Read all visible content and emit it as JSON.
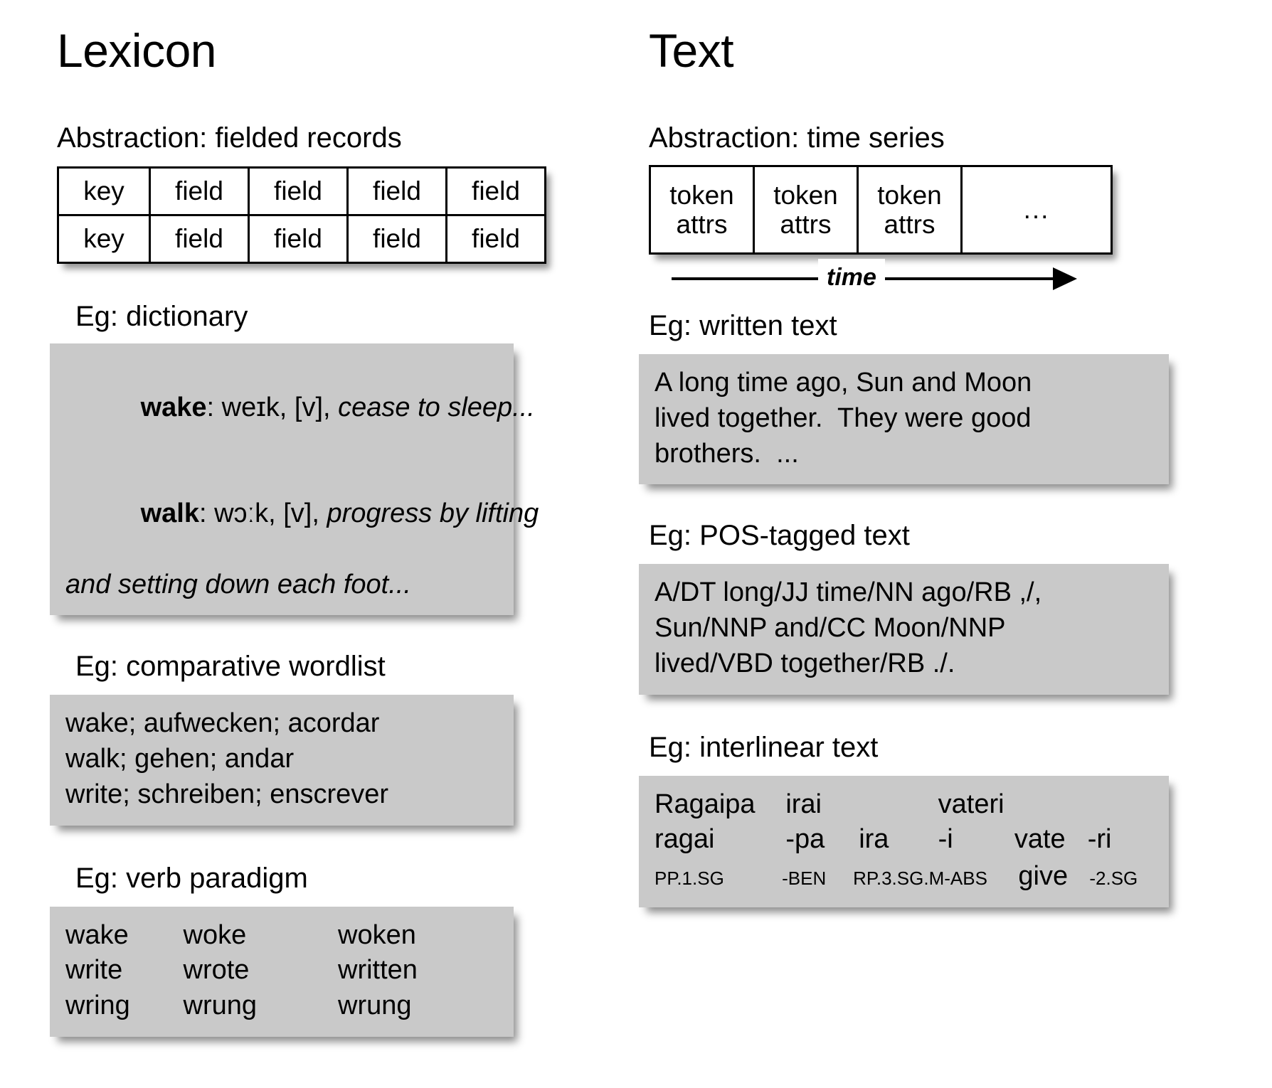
{
  "columns": {
    "lexicon": {
      "title": "Lexicon",
      "abstraction_heading": "Abstraction: fielded records",
      "table": {
        "rows": [
          [
            "key",
            "field",
            "field",
            "field",
            "field"
          ],
          [
            "key",
            "field",
            "field",
            "field",
            "field"
          ]
        ]
      },
      "examples": [
        {
          "heading": "Eg: dictionary",
          "entries": [
            {
              "headword": "wake",
              "separator": ": ",
              "pronunciation": "weɪk, ",
              "pos": "[v], ",
              "definition": "cease to sleep..."
            },
            {
              "headword": "walk",
              "separator": ": ",
              "pronunciation": "wɔːk, ",
              "pos": "[v], ",
              "definition": "progress by lifting",
              "definition_cont": "and setting down each foot..."
            }
          ]
        },
        {
          "heading": "Eg: comparative wordlist",
          "lines": [
            "wake; aufwecken; acordar",
            "walk; gehen; andar",
            "write; schreiben; enscrever"
          ]
        },
        {
          "heading": "Eg: verb paradigm",
          "rows": [
            [
              "wake",
              "woke",
              "woken"
            ],
            [
              "write",
              "wrote",
              "written"
            ],
            [
              "wring",
              "wrung",
              "wrung"
            ]
          ]
        }
      ]
    },
    "text": {
      "title": "Text",
      "abstraction_heading": "Abstraction: time series",
      "table": {
        "cells": [
          {
            "line1": "token",
            "line2": "attrs"
          },
          {
            "line1": "token",
            "line2": "attrs"
          },
          {
            "line1": "token",
            "line2": "attrs"
          }
        ],
        "ellipsis": "..."
      },
      "time_axis_label": "time",
      "examples": [
        {
          "heading": "Eg: written text",
          "lines": [
            "A long time ago, Sun and Moon",
            "lived together.  They were good",
            "brothers.  ..."
          ]
        },
        {
          "heading": "Eg: POS-tagged text",
          "lines": [
            "A/DT long/JJ time/NN ago/RB ,/,",
            "Sun/NNP and/CC Moon/NNP",
            "lived/VBD together/RB ./."
          ]
        },
        {
          "heading": "Eg: interlinear text",
          "gloss": {
            "line_source": [
              "Ragaipa",
              "irai",
              "",
              "vateri",
              "",
              ""
            ],
            "line_morphemes": [
              "ragai",
              "-pa",
              "ira",
              "-i",
              "vate",
              "-ri"
            ],
            "line_glosses": [
              "PP.1.SG",
              "-BEN",
              "RP.3.SG.M",
              "-ABS",
              "give",
              "-2.SG"
            ],
            "gloss_emphasis_index": 4
          }
        }
      ]
    }
  },
  "colors": {
    "background": "#ffffff",
    "example_box": "#c9c9c9",
    "ink": "#000000"
  }
}
